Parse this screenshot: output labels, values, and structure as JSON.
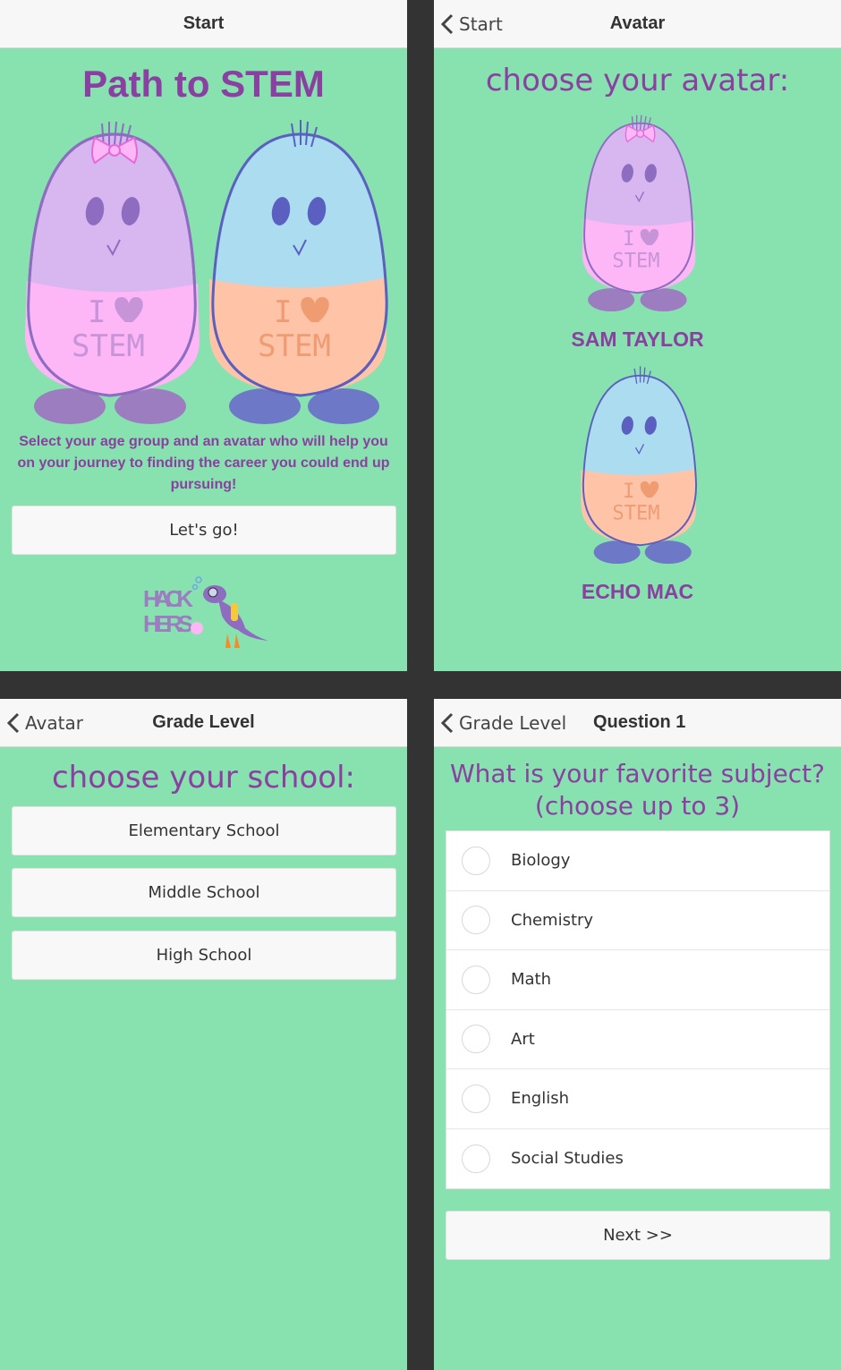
{
  "colors": {
    "panel_bg": "#88e2b0",
    "accent_purple": "#8a40a0",
    "divider": "#333333"
  },
  "screen1": {
    "nav_title": "Start",
    "heading": "Path to STEM",
    "avatars": [
      {
        "shirt_line1": "I",
        "shirt_line2": "STEM"
      },
      {
        "shirt_line1": "I",
        "shirt_line2": "STEM"
      }
    ],
    "intro_text": "Select your age group and an avatar who will help you on your journey to finding the career you could end up pursuing!",
    "button_label": "Let's go!",
    "logo_text_top": "HACK",
    "logo_text_bottom": "HERS"
  },
  "screen2": {
    "back_label": "Start",
    "nav_title": "Avatar",
    "heading": "choose your avatar:",
    "avatars": [
      {
        "name": "SAM TAYLOR",
        "shirt_line1": "I",
        "shirt_line2": "STEM"
      },
      {
        "name": "ECHO MAC",
        "shirt_line1": "I",
        "shirt_line2": "STEM"
      }
    ]
  },
  "screen3": {
    "back_label": "Avatar",
    "nav_title": "Grade Level",
    "heading": "choose your school:",
    "options": [
      "Elementary School",
      "Middle School",
      "High School"
    ]
  },
  "screen4": {
    "back_label": "Grade Level",
    "nav_title": "Question 1",
    "question_line1": "What is your favorite subject?",
    "question_line2": "(choose up to 3)",
    "subjects": [
      "Biology",
      "Chemistry",
      "Math",
      "Art",
      "English",
      "Social Studies"
    ],
    "next_label": "Next >>"
  }
}
